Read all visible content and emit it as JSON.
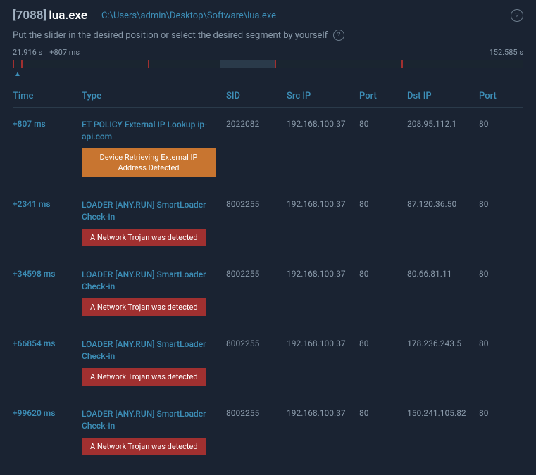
{
  "header": {
    "pid": "[7088]",
    "process_name": "lua.exe",
    "process_path": "C:\\Users\\admin\\Desktop\\Software\\lua.exe"
  },
  "instruction": "Put the slider in the desired position or select the desired segment by yourself",
  "time_labels": {
    "start": "21.916 s",
    "offset": "+807 ms",
    "end": "152.585 s"
  },
  "columns": {
    "time": "Time",
    "type": "Type",
    "sid": "SID",
    "srcip": "Src IP",
    "port1": "Port",
    "dstip": "Dst IP",
    "port2": "Port"
  },
  "rows": [
    {
      "time": "+807 ms",
      "type": "ET POLICY External IP Lookup ip-api.com",
      "badge": "Device Retrieving External IP Address Detected",
      "badge_class": "badge-orange",
      "sid": "2022082",
      "srcip": "192.168.100.37",
      "port1": "80",
      "dstip": "208.95.112.1",
      "port2": "80"
    },
    {
      "time": "+2341 ms",
      "type": "LOADER [ANY.RUN] SmartLoader Check-in",
      "badge": "A Network Trojan was detected",
      "badge_class": "badge-red",
      "sid": "8002255",
      "srcip": "192.168.100.37",
      "port1": "80",
      "dstip": "87.120.36.50",
      "port2": "80"
    },
    {
      "time": "+34598 ms",
      "type": "LOADER [ANY.RUN] SmartLoader Check-in",
      "badge": "A Network Trojan was detected",
      "badge_class": "badge-red",
      "sid": "8002255",
      "srcip": "192.168.100.37",
      "port1": "80",
      "dstip": "80.66.81.11",
      "port2": "80"
    },
    {
      "time": "+66854 ms",
      "type": "LOADER [ANY.RUN] SmartLoader Check-in",
      "badge": "A Network Trojan was detected",
      "badge_class": "badge-red",
      "sid": "8002255",
      "srcip": "192.168.100.37",
      "port1": "80",
      "dstip": "178.236.243.5",
      "port2": "80"
    },
    {
      "time": "+99620 ms",
      "type": "LOADER [ANY.RUN] SmartLoader Check-in",
      "badge": "A Network Trojan was detected",
      "badge_class": "badge-red",
      "sid": "8002255",
      "srcip": "192.168.100.37",
      "port1": "80",
      "dstip": "150.241.105.82",
      "port2": "80"
    }
  ]
}
